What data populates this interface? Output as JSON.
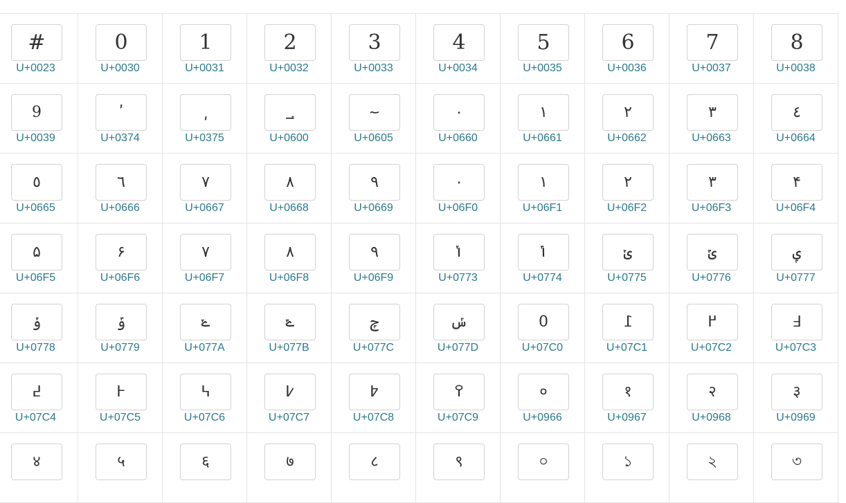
{
  "grid": {
    "cells": [
      {
        "glyph": "#",
        "code": "U+0023"
      },
      {
        "glyph": "0",
        "code": "U+0030"
      },
      {
        "glyph": "1",
        "code": "U+0031"
      },
      {
        "glyph": "2",
        "code": "U+0032"
      },
      {
        "glyph": "3",
        "code": "U+0033"
      },
      {
        "glyph": "4",
        "code": "U+0034"
      },
      {
        "glyph": "5",
        "code": "U+0035"
      },
      {
        "glyph": "6",
        "code": "U+0036"
      },
      {
        "glyph": "7",
        "code": "U+0037"
      },
      {
        "glyph": "8",
        "code": "U+0038"
      },
      {
        "glyph": "9",
        "code": "U+0039"
      },
      {
        "glyph": "ʹ",
        "code": "U+0374"
      },
      {
        "glyph": "͵",
        "code": "U+0375"
      },
      {
        "glyph": "؀",
        "code": "U+0600"
      },
      {
        "glyph": "؅",
        "code": "U+0605"
      },
      {
        "glyph": "٠",
        "code": "U+0660"
      },
      {
        "glyph": "١",
        "code": "U+0661"
      },
      {
        "glyph": "٢",
        "code": "U+0662"
      },
      {
        "glyph": "٣",
        "code": "U+0663"
      },
      {
        "glyph": "٤",
        "code": "U+0664"
      },
      {
        "glyph": "٥",
        "code": "U+0665"
      },
      {
        "glyph": "٦",
        "code": "U+0666"
      },
      {
        "glyph": "٧",
        "code": "U+0667"
      },
      {
        "glyph": "٨",
        "code": "U+0668"
      },
      {
        "glyph": "٩",
        "code": "U+0669"
      },
      {
        "glyph": "۰",
        "code": "U+06F0"
      },
      {
        "glyph": "۱",
        "code": "U+06F1"
      },
      {
        "glyph": "۲",
        "code": "U+06F2"
      },
      {
        "glyph": "۳",
        "code": "U+06F3"
      },
      {
        "glyph": "۴",
        "code": "U+06F4"
      },
      {
        "glyph": "۵",
        "code": "U+06F5"
      },
      {
        "glyph": "۶",
        "code": "U+06F6"
      },
      {
        "glyph": "۷",
        "code": "U+06F7"
      },
      {
        "glyph": "۸",
        "code": "U+06F8"
      },
      {
        "glyph": "۹",
        "code": "U+06F9"
      },
      {
        "glyph": "ݳ",
        "code": "U+0773"
      },
      {
        "glyph": "ݴ",
        "code": "U+0774"
      },
      {
        "glyph": "ݵ",
        "code": "U+0775"
      },
      {
        "glyph": "ݶ",
        "code": "U+0776"
      },
      {
        "glyph": "ݷ",
        "code": "U+0777"
      },
      {
        "glyph": "ݸ",
        "code": "U+0778"
      },
      {
        "glyph": "ݹ",
        "code": "U+0779"
      },
      {
        "glyph": "ݺ",
        "code": "U+077A"
      },
      {
        "glyph": "ݻ",
        "code": "U+077B"
      },
      {
        "glyph": "ݼ",
        "code": "U+077C"
      },
      {
        "glyph": "ݽ",
        "code": "U+077D"
      },
      {
        "glyph": "߀",
        "code": "U+07C0"
      },
      {
        "glyph": "߁",
        "code": "U+07C1"
      },
      {
        "glyph": "߂",
        "code": "U+07C2"
      },
      {
        "glyph": "߃",
        "code": "U+07C3"
      },
      {
        "glyph": "߄",
        "code": "U+07C4"
      },
      {
        "glyph": "߅",
        "code": "U+07C5"
      },
      {
        "glyph": "߆",
        "code": "U+07C6"
      },
      {
        "glyph": "߇",
        "code": "U+07C7"
      },
      {
        "glyph": "߈",
        "code": "U+07C8"
      },
      {
        "glyph": "߉",
        "code": "U+07C9"
      },
      {
        "glyph": "०",
        "code": "U+0966"
      },
      {
        "glyph": "१",
        "code": "U+0967"
      },
      {
        "glyph": "२",
        "code": "U+0968"
      },
      {
        "glyph": "३",
        "code": "U+0969"
      },
      {
        "glyph": "४",
        "code": ""
      },
      {
        "glyph": "५",
        "code": ""
      },
      {
        "glyph": "६",
        "code": ""
      },
      {
        "glyph": "७",
        "code": ""
      },
      {
        "glyph": "८",
        "code": ""
      },
      {
        "glyph": "९",
        "code": ""
      },
      {
        "glyph": "০",
        "code": ""
      },
      {
        "glyph": "১",
        "code": ""
      },
      {
        "glyph": "২",
        "code": ""
      },
      {
        "glyph": "৩",
        "code": ""
      }
    ]
  }
}
